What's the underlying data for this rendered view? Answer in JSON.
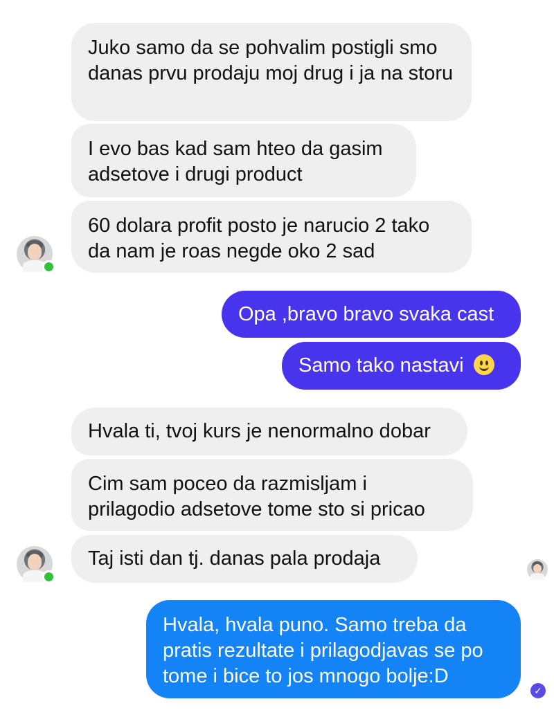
{
  "chat": {
    "messages": [
      {
        "sender": "contact",
        "text": "Juko samo da se pohvalim postigli smo danas prvu prodaju moj drug i ja na storu"
      },
      {
        "sender": "contact",
        "text": "I evo bas kad sam hteo da gasim adsetove i drugi product"
      },
      {
        "sender": "contact",
        "text": "60 dolara profit posto je narucio 2 tako da nam je roas negde oko 2 sad"
      },
      {
        "sender": "me",
        "text": "Opa ,bravo bravo svaka cast"
      },
      {
        "sender": "me",
        "text": "Samo tako nastavi",
        "emoji": "smiling-face-emoji"
      },
      {
        "sender": "contact",
        "text": "Hvala ti, tvoj kurs je nenormalno dobar"
      },
      {
        "sender": "contact",
        "text": "Cim sam poceo da razmisljam i prilagodio adsetove tome sto si pricao"
      },
      {
        "sender": "contact",
        "text": "Taj isti dan tj. danas pala prodaja"
      },
      {
        "sender": "me",
        "text": "Hvala, hvala puno. Samo treba da pratis rezultate i prilagodjavas se po tome i bice to jos mnogo bolje:D"
      }
    ]
  },
  "colors": {
    "incoming_bubble": "#efefef",
    "outgoing_purple": "#4834ec",
    "outgoing_blue": "#1483f5",
    "online_status": "#31c23a",
    "read_receipt": "#5b49e8"
  },
  "icons": {
    "contact_avatar": "contact-avatar",
    "online_status": "online-status-dot",
    "seen_avatar": "seen-avatar",
    "delivered": "delivered-check-icon"
  }
}
